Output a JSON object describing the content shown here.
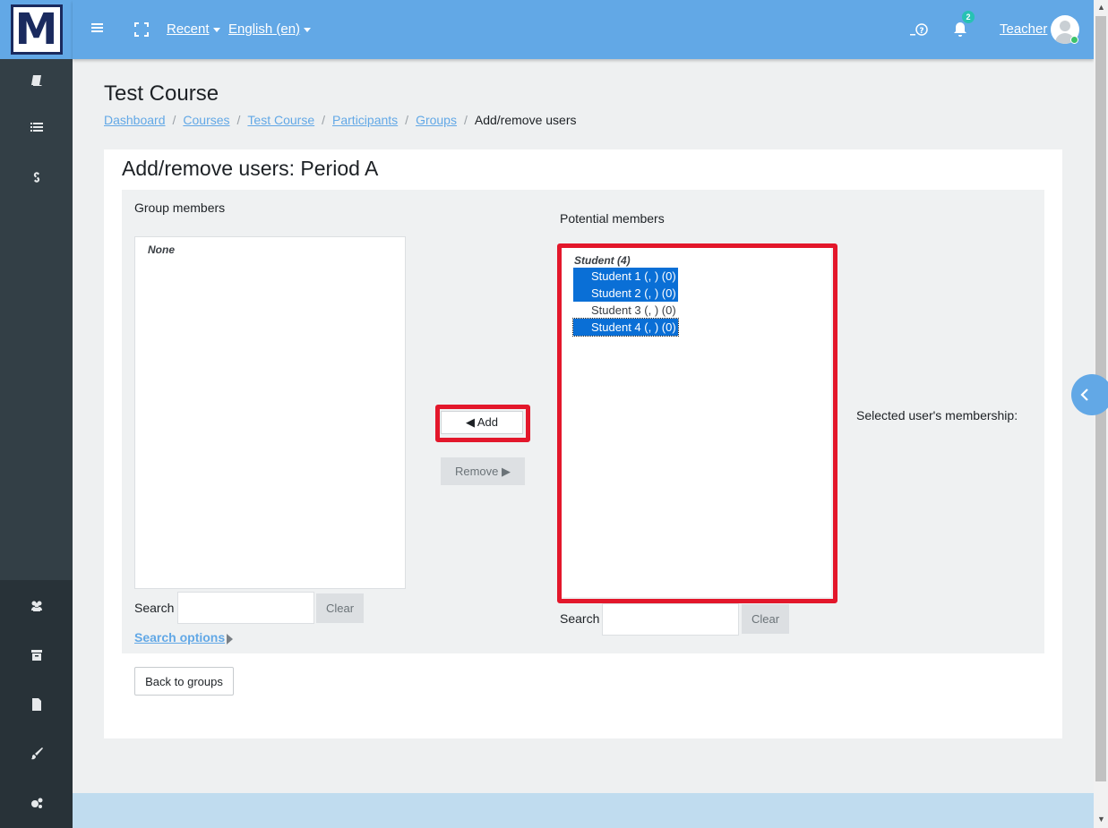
{
  "topbar": {
    "recent_label": "Recent",
    "language_label": "English (en)",
    "notification_count": "2",
    "user_name": "Teacher"
  },
  "logo": {
    "letter": "M"
  },
  "header": {
    "title": "Test Course",
    "breadcrumb": [
      "Dashboard",
      "Courses",
      "Test Course",
      "Participants",
      "Groups",
      "Add/remove users"
    ]
  },
  "main": {
    "title": "Add/remove users: Period A",
    "group_members": {
      "label": "Group members",
      "empty_text": "None",
      "search_label": "Search",
      "search_value": "",
      "clear_label": "Clear",
      "search_options_label": "Search options"
    },
    "buttons": {
      "add_label": "◀ Add",
      "remove_label": "Remove ▶"
    },
    "potential_members": {
      "label": "Potential members",
      "group_label": "Student (4)",
      "options": [
        {
          "label": "Student 1 (, ) (0)",
          "selected": true
        },
        {
          "label": "Student 2 (, ) (0)",
          "selected": true
        },
        {
          "label": "Student 3 (, ) (0)",
          "selected": false
        },
        {
          "label": "Student 4 (, ) (0)",
          "selected": true
        }
      ],
      "search_label": "Search",
      "search_value": "",
      "clear_label": "Clear"
    },
    "membership_label": "Selected user's membership:",
    "back_label": "Back to groups"
  },
  "colors": {
    "topbar": "#62a8e6",
    "sidebar": "#333f46",
    "selection": "#0a6fd6",
    "highlight": "#e3172b"
  }
}
